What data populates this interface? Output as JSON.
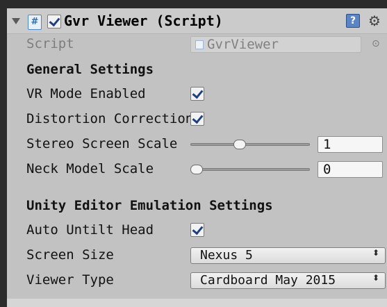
{
  "component": {
    "title": "Gvr Viewer (Script)",
    "enabled": true,
    "icons": {
      "component": "script-icon",
      "help": "help-icon",
      "settings": "gear-icon"
    }
  },
  "script_field": {
    "label": "Script",
    "value": "GvrViewer"
  },
  "general_settings": {
    "heading": "General Settings",
    "vr_mode_enabled": {
      "label": "VR Mode Enabled",
      "checked": true
    },
    "distortion_correction": {
      "label": "Distortion Correction",
      "checked": true
    },
    "stereo_screen_scale": {
      "label": "Stereo Screen Scale",
      "value": "1",
      "fraction": 0.4
    },
    "neck_model_scale": {
      "label": "Neck Model Scale",
      "value": "0",
      "fraction": 0.0
    }
  },
  "editor_emulation": {
    "heading": "Unity Editor Emulation Settings",
    "auto_untilt_head": {
      "label": "Auto Untilt Head",
      "checked": true
    },
    "screen_size": {
      "label": "Screen Size",
      "value": "Nexus 5"
    },
    "viewer_type": {
      "label": "Viewer Type",
      "value": "Cardboard May 2015"
    }
  },
  "colors": {
    "panel": "#c2c2c2",
    "window": "#2b2b2b",
    "check": "#1e3f80"
  }
}
